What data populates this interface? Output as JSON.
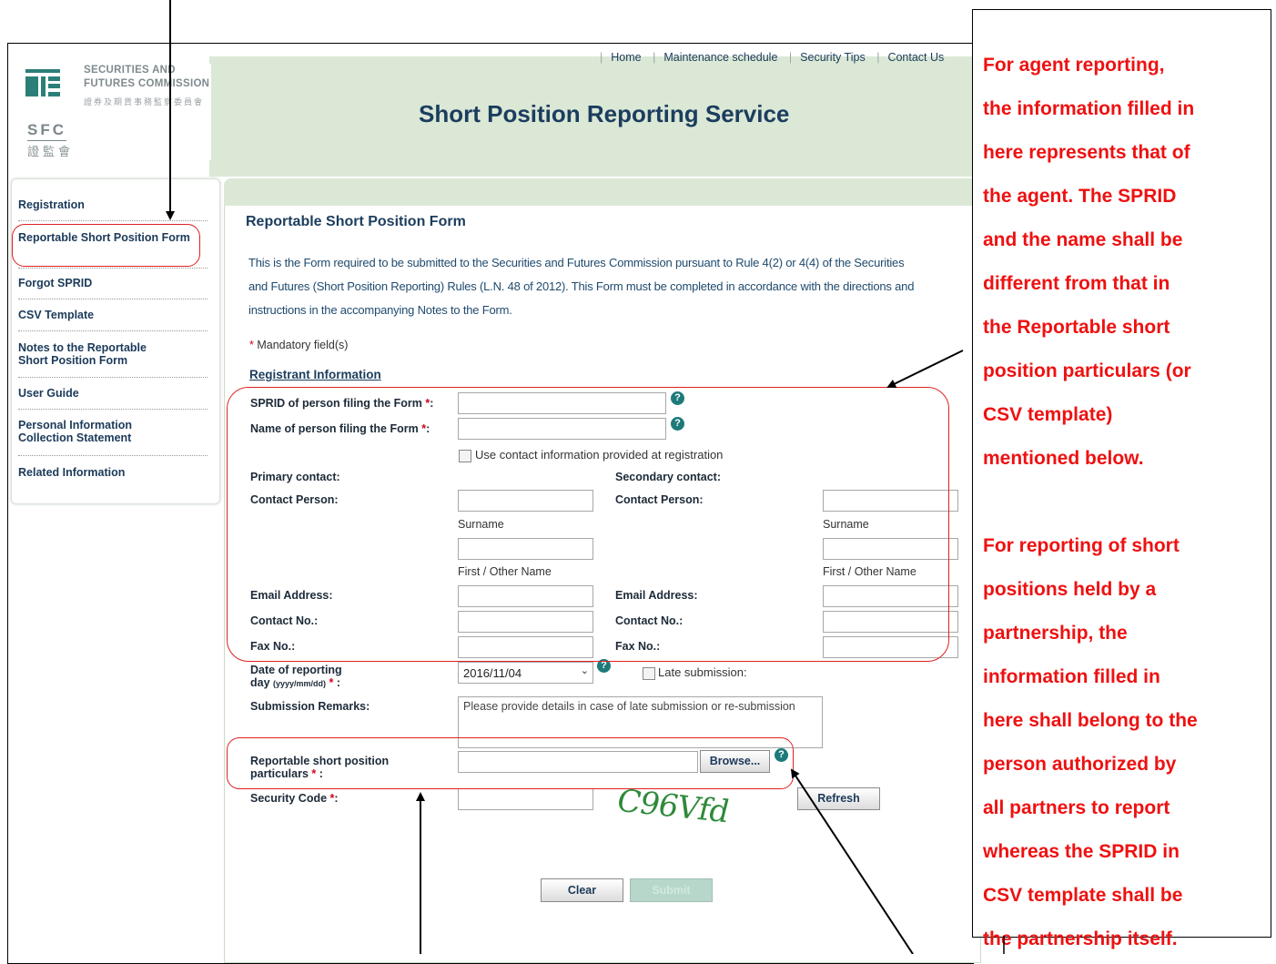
{
  "header": {
    "logo": {
      "en_line1": "SECURITIES AND",
      "en_line2": "FUTURES COMMISSION",
      "zh_line": "證券及期貨事務監察委員會",
      "abbr": "SFC",
      "abbr_zh": "證監會"
    },
    "nav": [
      "Home",
      "Maintenance schedule",
      "Security Tips",
      "Contact Us"
    ],
    "title": "Short Position Reporting Service"
  },
  "sidebar": {
    "items": [
      {
        "label": "Registration"
      },
      {
        "label": "Reportable Short Position Form"
      },
      {
        "label": "Forgot SPRID"
      },
      {
        "label": "CSV Template"
      },
      {
        "label": "Notes to the Reportable Short Position Form"
      },
      {
        "label": "User Guide"
      },
      {
        "label": "Personal Information Collection Statement"
      },
      {
        "label": "Related Information"
      }
    ]
  },
  "form": {
    "title": "Reportable Short Position Form",
    "intro": "This is the Form required to be submitted to the Securities and Futures Commission pursuant to Rule 4(2) or 4(4) of the Securities and Futures (Short Position Reporting) Rules (L.N. 48 of 2012). This Form must be completed in accordance with the directions and instructions in the accompanying Notes to the Form.",
    "mandatory_note": "Mandatory field(s)",
    "section_registrant": "Registrant Information",
    "sprid_label": "SPRID of person filing the Form",
    "name_label": "Name of person filing the Form",
    "use_contact_label": "Use contact information provided at registration",
    "primary_contact": "Primary contact:",
    "secondary_contact": "Secondary contact:",
    "contact_person": "Contact Person:",
    "surname": "Surname",
    "first_name": "First / Other Name",
    "email": "Email Address:",
    "contact_no": "Contact No.:",
    "fax_no": "Fax No.:",
    "date_label": "Date of reporting",
    "date_label2": "day",
    "date_format": "(yyyy/mm/dd)",
    "date_value": "2016/11/04",
    "late_label": "Late submission:",
    "remarks_label": "Submission Remarks:",
    "remarks_placeholder": "Please provide details in case of late submission or re-submission",
    "particulars_label": "Reportable short position particulars",
    "browse_label": "Browse...",
    "security_label": "Security Code",
    "captcha_text": "C96Vfd",
    "refresh_label": "Refresh",
    "clear_label": "Clear",
    "submit_label": "Submit"
  },
  "callout": {
    "lines": [
      "For agent reporting,",
      "the information filled in",
      "here represents that of",
      "the agent. The SPRID",
      "and the name shall be",
      "different from that in",
      "the Reportable short",
      "position particulars (or",
      "CSV template)",
      "mentioned below.",
      "",
      "For reporting of short",
      "positions held by a",
      "partnership, the",
      "information filled in",
      "here shall belong to the",
      "person authorized by",
      "all partners to report",
      "whereas the SPRID in",
      "CSV template shall be",
      "the partnership itself."
    ]
  },
  "colors": {
    "banner": "#dbe8d6",
    "highlight_red": "#e02020",
    "callout_text": "#ee1111",
    "title_navy": "#1b3d5e"
  }
}
